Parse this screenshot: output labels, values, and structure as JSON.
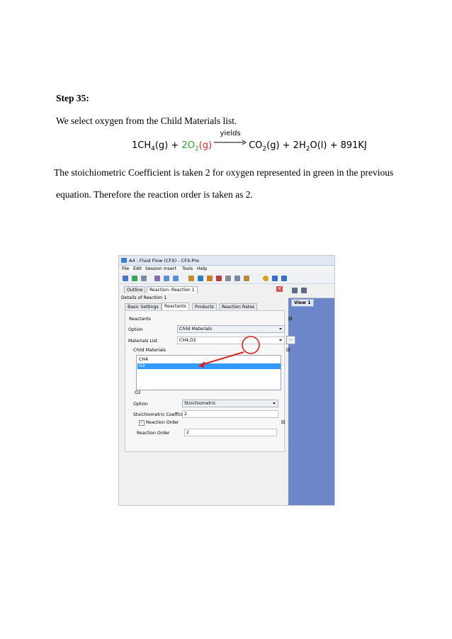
{
  "doc": {
    "step_title": "Step 35:",
    "intro": "We select oxygen from the Child Materials list.",
    "equation": {
      "coef_ch4": "1CH",
      "ch4_sub": "4",
      "g1": "(g) + ",
      "o2_coef": "2O",
      "o2_sub": "2",
      "o2_state": "(g)",
      "arrow_label": "yields",
      "co2": "CO",
      "co2_sub": "2",
      "g3": "(g) + 2H",
      "h2o_sub": "2",
      "rest": "O(l) + 891KJ"
    },
    "para2_line1": " The stoichiometric Coefficient is taken 2 for oxygen represented in green in the previous",
    "para2_line2": "equation. Therefore the reaction order is taken as 2."
  },
  "app": {
    "title": "A4 : Fluid Flow (CFX) - CFX-Pre",
    "menu": [
      "File",
      "Edit",
      "Session",
      "Insert",
      "Tools",
      "Help"
    ],
    "tabs_top": [
      "Outline",
      "Reaction: Reaction 1"
    ],
    "details_title": "Details of Reaction 1",
    "tabs_inner": [
      "Basic Settings",
      "Reactants",
      "Products",
      "Reaction Rates"
    ],
    "reactants_header": "Reactants",
    "option_label": "Option",
    "option_value": "Child Materials",
    "materials_list_label": "Materials List",
    "materials_list_value": "CH4,O2",
    "ellipsis": "...",
    "child_materials_label": "Child Materials",
    "child_items": [
      "CH4",
      "O2"
    ],
    "o2_section": "O2",
    "o2_option_label": "Option",
    "o2_option_value": "Stoichiometric",
    "stoich_label": "Stoichiometric Coefficie",
    "stoich_value": "2",
    "reaction_order_check": "Reaction Order",
    "reaction_order_label": "Reaction Order",
    "reaction_order_value": "2",
    "view_label": "View 1",
    "collapse_glyph": "⊟"
  },
  "colors": {
    "green": "#2ca02c",
    "red": "#d62728",
    "selection": "#3399ff",
    "viewport": "#6d86c9"
  }
}
